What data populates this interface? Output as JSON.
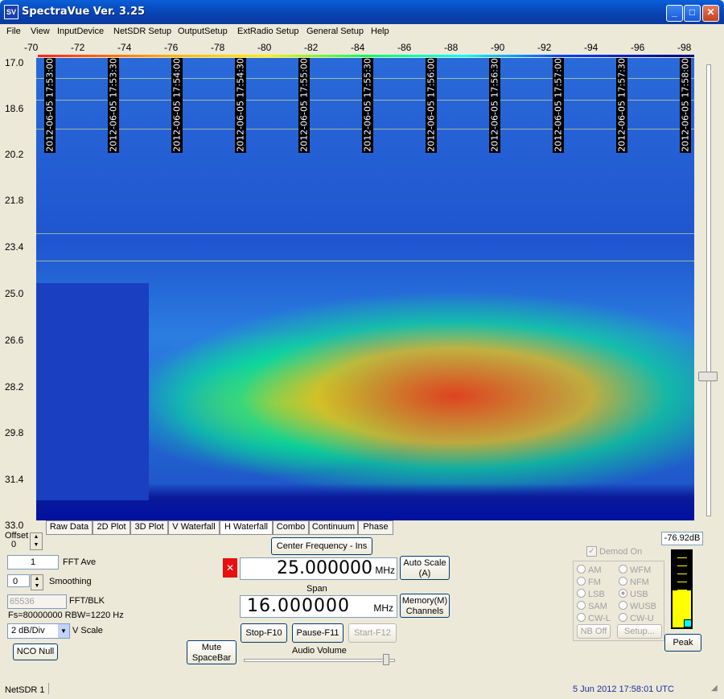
{
  "window": {
    "icon": "SV",
    "title": "SpectraVue Ver. 3.25",
    "minimize": "_",
    "maximize": "□",
    "close": "✕"
  },
  "menu": [
    "File",
    "View",
    "InputDevice",
    "NetSDR Setup",
    "OutputSetup",
    "ExtRadio Setup",
    "General Setup",
    "Help"
  ],
  "scale_labels": [
    "-70",
    "-72",
    "-74",
    "-76",
    "-78",
    "-80",
    "-82",
    "-84",
    "-86",
    "-88",
    "-90",
    "-92",
    "-94",
    "-96",
    "-98"
  ],
  "y_labels": [
    "17.0",
    "18.6",
    "20.2",
    "21.8",
    "23.4",
    "25.0",
    "26.6",
    "28.2",
    "29.8",
    "31.4",
    "33.0"
  ],
  "timestamps": [
    "2012-06-05 17:53:00",
    "2012-06-05 17:53:30",
    "2012-06-05 17:54:00",
    "2012-06-05 17:54:30",
    "2012-06-05 17:55:00",
    "2012-06-05 17:55:30",
    "2012-06-05 17:56:00",
    "2012-06-05 17:56:30",
    "2012-06-05 17:57:00",
    "2012-06-05 17:57:30",
    "2012-06-05 17:58:00"
  ],
  "tabs": [
    "Raw Data",
    "2D Plot",
    "3D Plot",
    "V Waterfall",
    "H Waterfall",
    "Combo",
    "Continuum",
    "Phase"
  ],
  "controls": {
    "offset_label": "Offset",
    "offset_value": "0",
    "fft_ave_value": "1",
    "fft_ave_label": "FFT Ave",
    "smoothing_value": "0",
    "smoothing_label": "Smoothing",
    "fft_blk_value": "65536",
    "fft_blk_label": "FFT/BLK",
    "fs_text": "Fs=80000000 RBW=1220 Hz",
    "vscale_value": "2 dB/Div",
    "vscale_label": "V Scale",
    "nco_null": "NCO Null"
  },
  "center": {
    "button": "Center Frequency - Ins",
    "frequency": "25.000000",
    "unit": "MHz",
    "span_label": "Span",
    "span_value": "16.000000",
    "span_unit": "MHz",
    "auto_scale": "Auto Scale\n(A)",
    "memory": "Memory(M)\nChannels"
  },
  "transport": {
    "mute": "Mute\nSpaceBar",
    "stop": "Stop-F10",
    "pause": "Pause-F11",
    "start": "Start-F12",
    "volume_label": "Audio Volume"
  },
  "demod": {
    "checkbox": "Demod On",
    "modes_left": [
      "AM",
      "FM",
      "LSB",
      "SAM",
      "CW-L"
    ],
    "modes_right": [
      "WFM",
      "NFM",
      "USB",
      "WUSB",
      "CW-U"
    ],
    "selected": "USB",
    "nb_off": "NB Off",
    "setup": "Setup..."
  },
  "meter": {
    "readout": "-76.92dB",
    "peak": "Peak",
    "level": 0.48
  },
  "status": {
    "left": "NetSDR 1",
    "datetime": "5 Jun 2012  17:58:01 UTC"
  },
  "colors": {
    "title_blue": "#0841b0",
    "status_blue": "#1a2fa0",
    "freq_red": "#e81010"
  }
}
